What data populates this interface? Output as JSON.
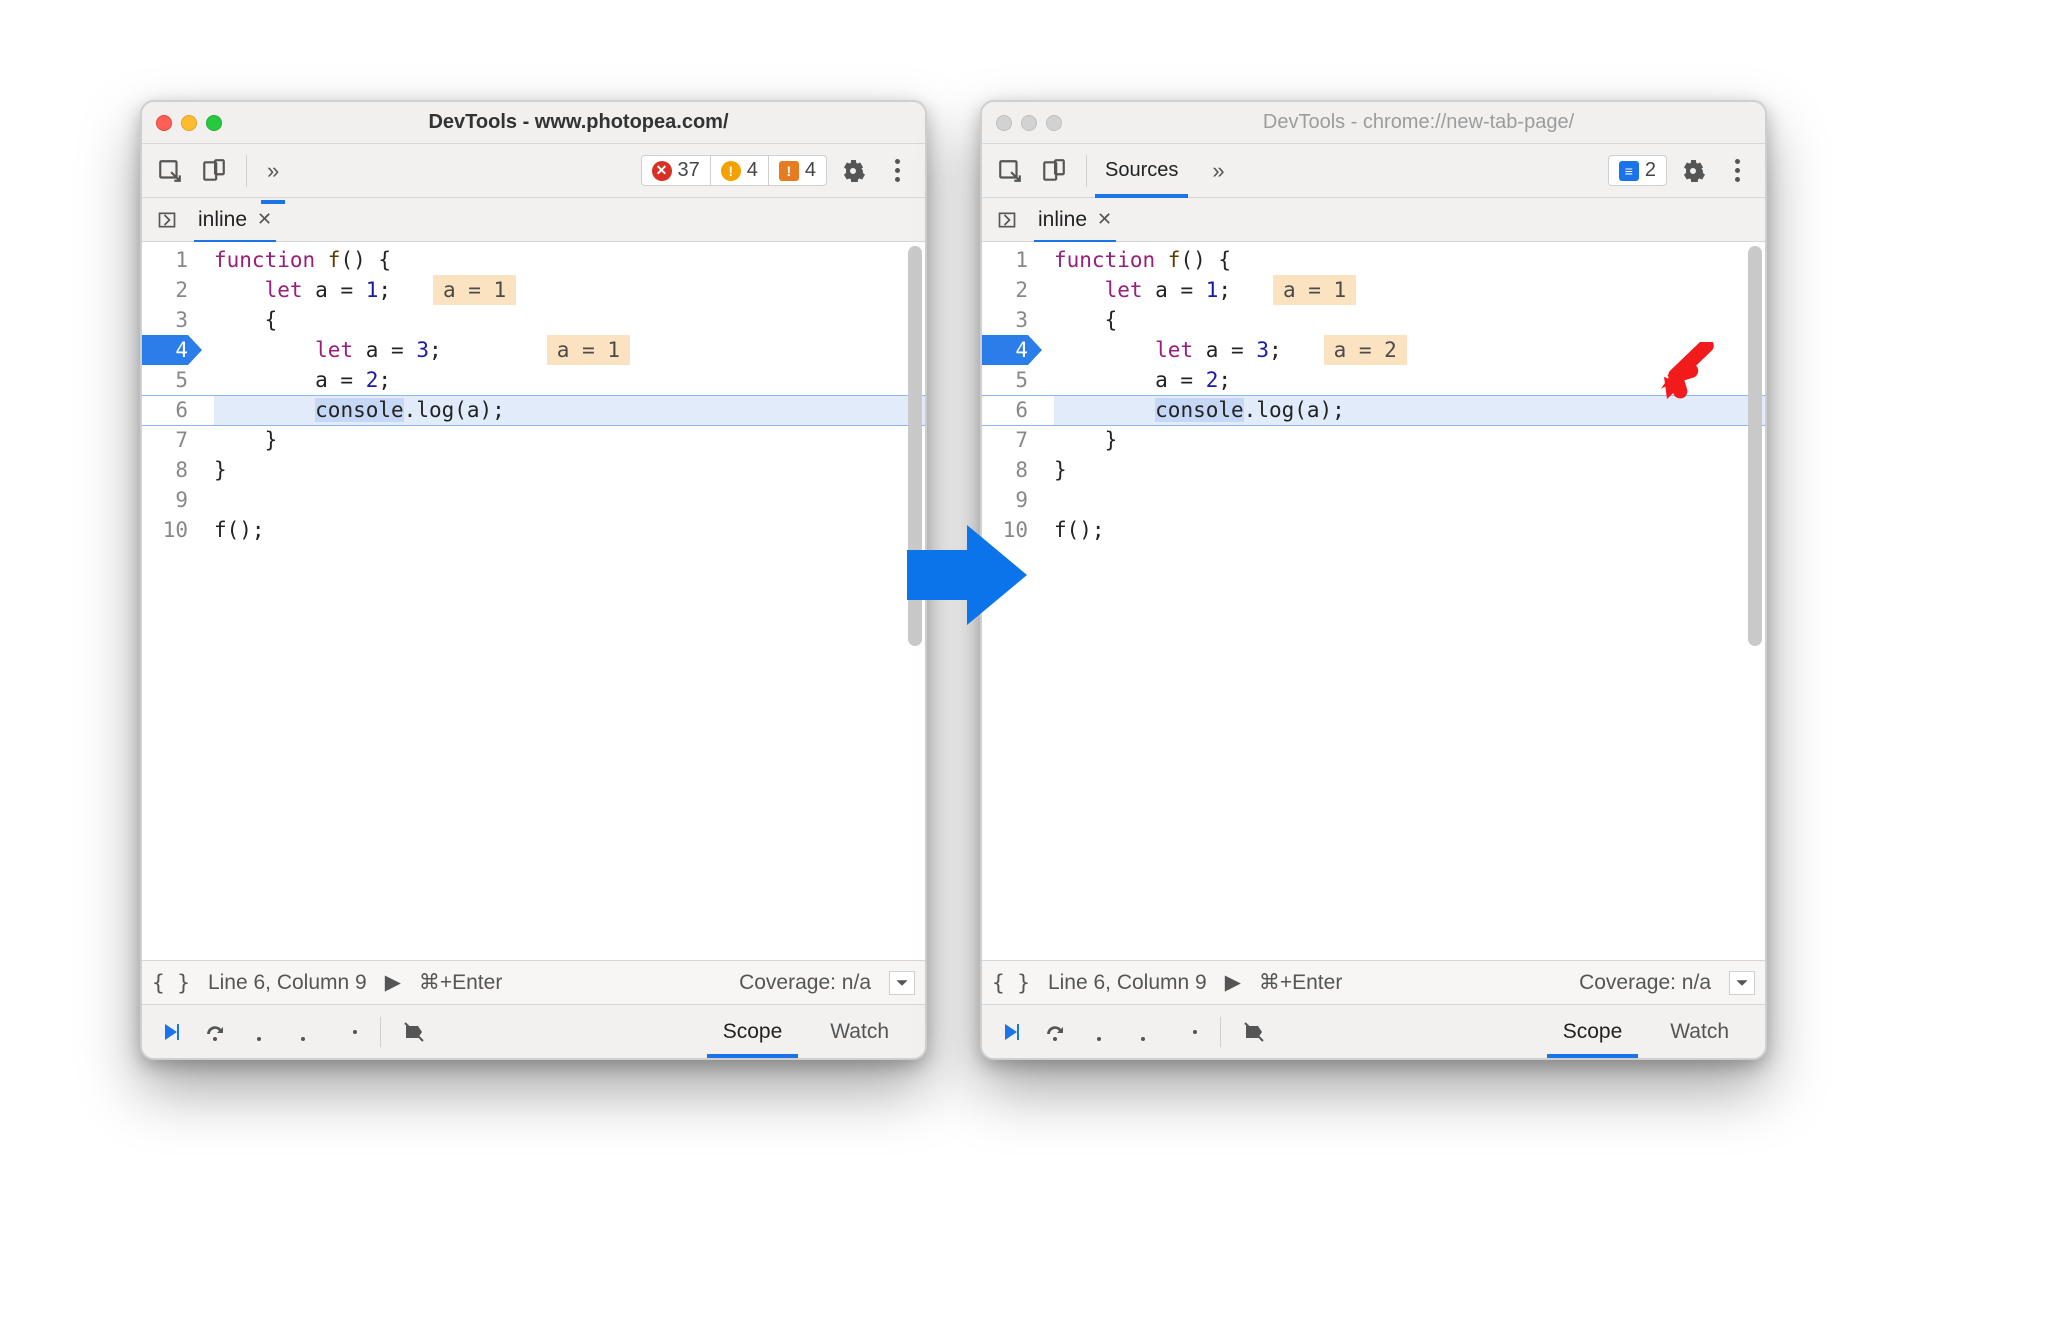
{
  "windows": [
    {
      "id": "left",
      "active": true,
      "title": "DevTools - www.photopea.com/",
      "toolbar": {
        "more": "»",
        "badges": {
          "errors": "37",
          "warnings": "4",
          "issues": "4"
        }
      },
      "tab": {
        "name": "inline"
      },
      "code": {
        "exec_line": 4,
        "highlight_line": 6,
        "lines": [
          {
            "n": 1,
            "tokens": [
              [
                "kw",
                "function"
              ],
              [
                "",
                ""
              ],
              [
                "fn",
                " f"
              ],
              [
                "",
                "() {"
              ]
            ]
          },
          {
            "n": 2,
            "tokens": [
              [
                "",
                "    "
              ],
              [
                "kw",
                "let"
              ],
              [
                "",
                " a = "
              ],
              [
                "num",
                "1"
              ],
              [
                "",
                ";"
              ]
            ],
            "annotation": "a = 1"
          },
          {
            "n": 3,
            "tokens": [
              [
                "",
                "    {"
              ]
            ]
          },
          {
            "n": 4,
            "tokens": [
              [
                "",
                "        "
              ],
              [
                "kw",
                "let"
              ],
              [
                "",
                " a = "
              ],
              [
                "num",
                "3"
              ],
              [
                "",
                ";"
              ]
            ],
            "annotation": "a = 1",
            "annotation_gap": "        "
          },
          {
            "n": 5,
            "tokens": [
              [
                "",
                "        a = "
              ],
              [
                "num",
                "2"
              ],
              [
                "",
                ";"
              ]
            ]
          },
          {
            "n": 6,
            "tokens": [
              [
                "",
                "        "
              ],
              [
                "sel",
                "console"
              ],
              [
                "",
                ".log(a);"
              ]
            ]
          },
          {
            "n": 7,
            "tokens": [
              [
                "",
                "    }"
              ]
            ]
          },
          {
            "n": 8,
            "tokens": [
              [
                "",
                "}"
              ]
            ]
          },
          {
            "n": 9,
            "tokens": [
              [
                "",
                ""
              ]
            ]
          },
          {
            "n": 10,
            "tokens": [
              [
                "",
                "f();"
              ]
            ]
          }
        ]
      },
      "status": {
        "pos": "Line 6, Column 9",
        "run": "⌘+Enter",
        "coverage": "Coverage: n/a"
      },
      "debug": {
        "scope": "Scope",
        "watch": "Watch"
      }
    },
    {
      "id": "right",
      "active": false,
      "title": "DevTools - chrome://new-tab-page/",
      "toolbar": {
        "sources_tab": "Sources",
        "more": "»",
        "badges": {
          "messages": "2"
        }
      },
      "tab": {
        "name": "inline"
      },
      "code": {
        "exec_line": 4,
        "highlight_line": 6,
        "lines": [
          {
            "n": 1,
            "tokens": [
              [
                "kw",
                "function"
              ],
              [
                "",
                ""
              ],
              [
                "fn",
                " f"
              ],
              [
                "",
                "() {"
              ]
            ]
          },
          {
            "n": 2,
            "tokens": [
              [
                "",
                "    "
              ],
              [
                "kw",
                "let"
              ],
              [
                "",
                " a = "
              ],
              [
                "num",
                "1"
              ],
              [
                "",
                ";"
              ]
            ],
            "annotation": "a = 1"
          },
          {
            "n": 3,
            "tokens": [
              [
                "",
                "    {"
              ]
            ]
          },
          {
            "n": 4,
            "tokens": [
              [
                "",
                "        "
              ],
              [
                "kw",
                "let"
              ],
              [
                "",
                " a = "
              ],
              [
                "num",
                "3"
              ],
              [
                "",
                ";"
              ]
            ],
            "annotation": "a = 2"
          },
          {
            "n": 5,
            "tokens": [
              [
                "",
                "        a = "
              ],
              [
                "num",
                "2"
              ],
              [
                "",
                ";"
              ]
            ]
          },
          {
            "n": 6,
            "tokens": [
              [
                "",
                "        "
              ],
              [
                "sel",
                "console"
              ],
              [
                "",
                ".log(a);"
              ]
            ]
          },
          {
            "n": 7,
            "tokens": [
              [
                "",
                "    }"
              ]
            ]
          },
          {
            "n": 8,
            "tokens": [
              [
                "",
                "}"
              ]
            ]
          },
          {
            "n": 9,
            "tokens": [
              [
                "",
                ""
              ]
            ]
          },
          {
            "n": 10,
            "tokens": [
              [
                "",
                "f();"
              ]
            ]
          }
        ],
        "red_arrow_near_line": 4
      },
      "status": {
        "pos": "Line 6, Column 9",
        "run": "⌘+Enter",
        "coverage": "Coverage: n/a"
      },
      "debug": {
        "scope": "Scope",
        "watch": "Watch"
      }
    }
  ]
}
